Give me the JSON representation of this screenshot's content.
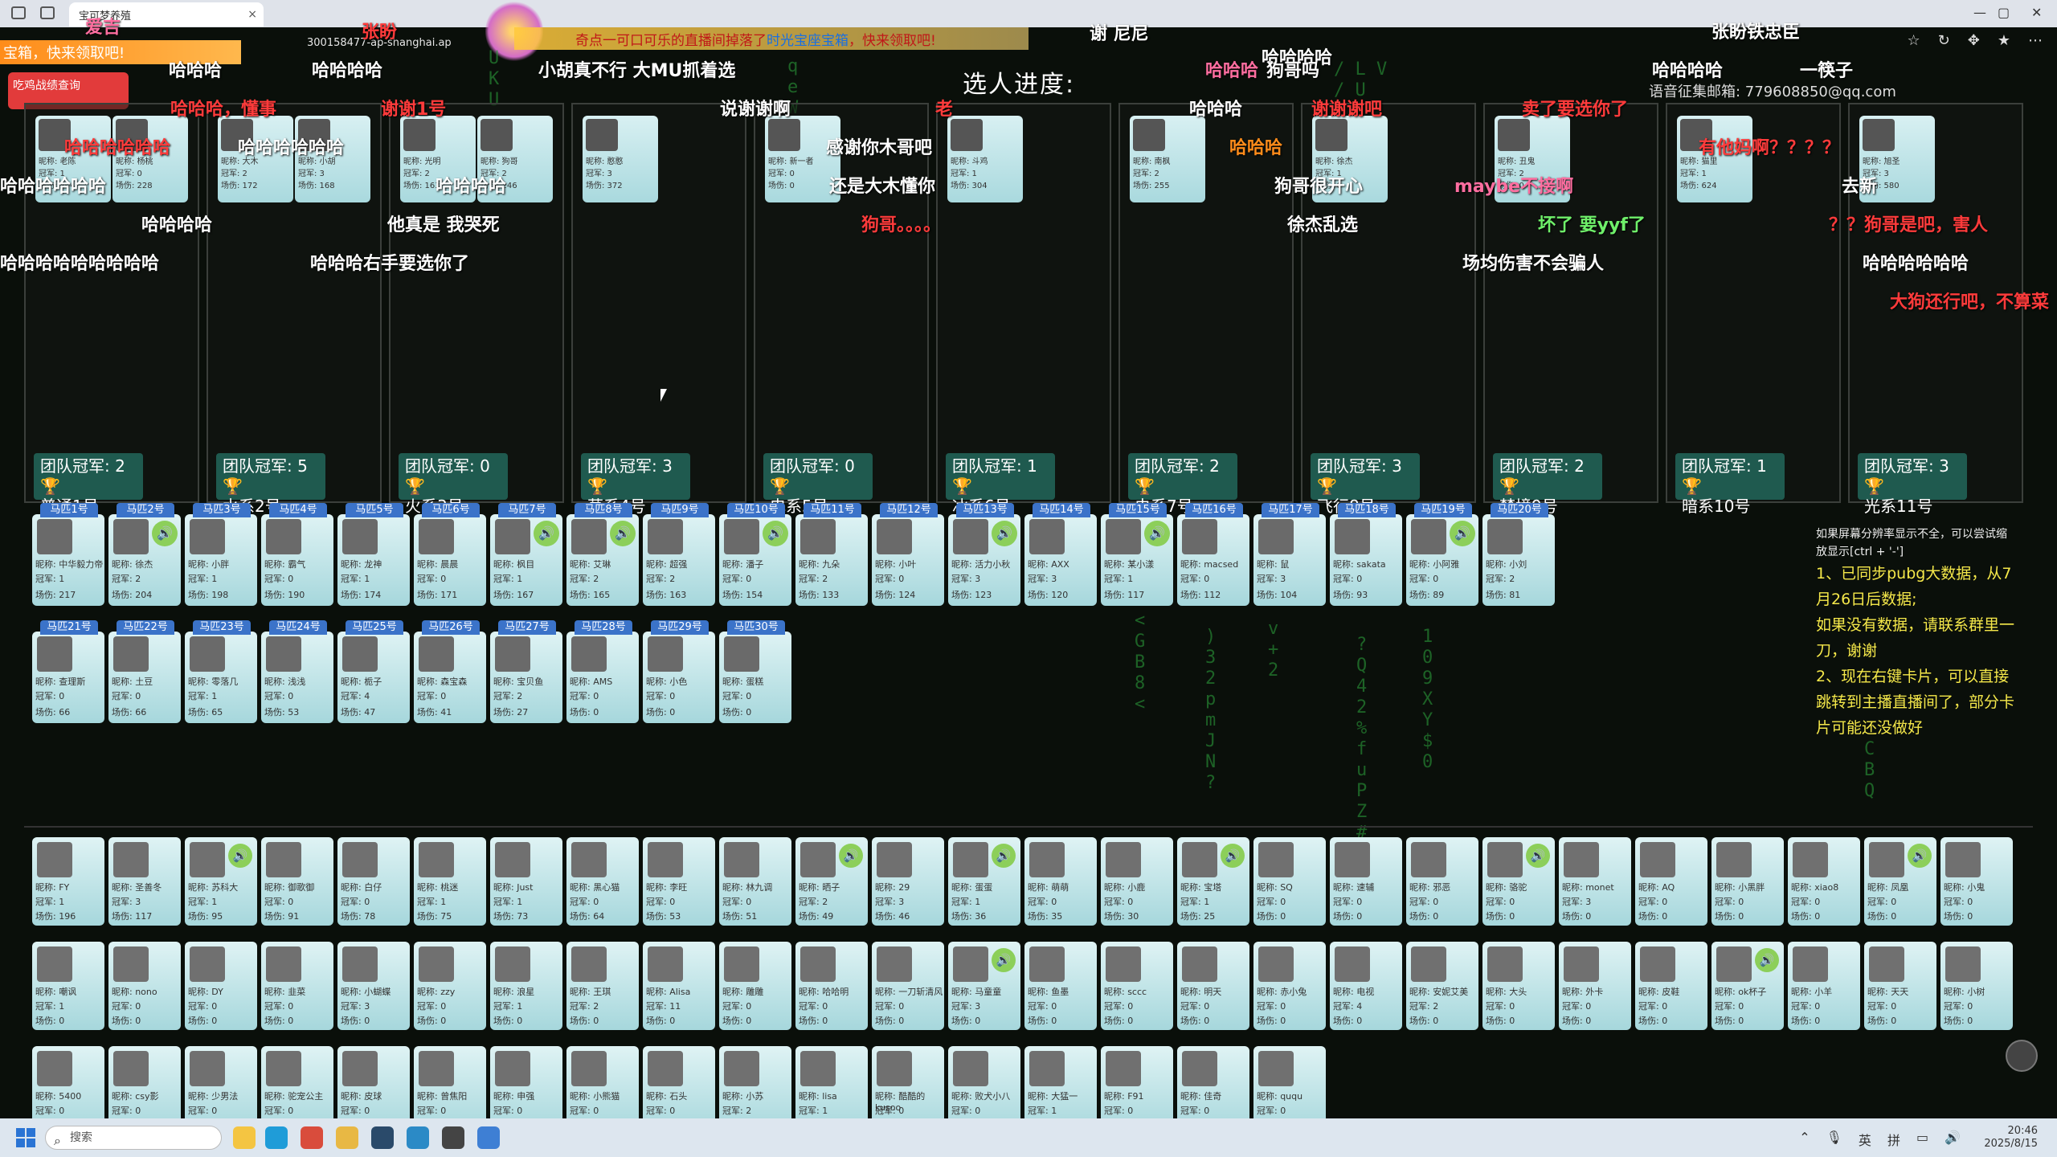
{
  "browser": {
    "tab_title": "宝可梦养殖",
    "url": "300158477-ap-shanghai.ap",
    "tab_close": "×"
  },
  "banner": {
    "prefix": "奇点一可口可乐的直播间掉落了",
    "highlight": "时光宝座宝箱",
    "suffix": "，快来领取吧!"
  },
  "left_promo": "宝箱，快来领取吧!",
  "left_box": "吃鸡战绩查询",
  "stage_title": "选人进度:",
  "contact": "语音征集邮箱: 779608850@qq.com",
  "teams": [
    {
      "badge_count": "团队冠军: 2",
      "name": "普通1号"
    },
    {
      "badge_count": "团队冠军: 5",
      "name": "水系2号"
    },
    {
      "badge_count": "团队冠军: 0",
      "name": "火系3号"
    },
    {
      "badge_count": "团队冠军: 3",
      "name": "草系4号"
    },
    {
      "badge_count": "团队冠军: 0",
      "name": "电系5号"
    },
    {
      "badge_count": "团队冠军: 1",
      "name": "冰系6号"
    },
    {
      "badge_count": "团队冠军: 2",
      "name": "虫系7号"
    },
    {
      "badge_count": "团队冠军: 3",
      "name": "飞行8号"
    },
    {
      "badge_count": "团队冠军: 2",
      "name": "梦境9号"
    },
    {
      "badge_count": "团队冠军: 1",
      "name": "暗系10号"
    },
    {
      "badge_count": "团队冠军: 3",
      "name": "光系11号"
    }
  ],
  "team_members": [
    [
      {
        "nick": "昵称: 老陈",
        "crown": "冠军: 1",
        "games": "场伤: 204"
      },
      {
        "nick": "昵称: 杨桃",
        "crown": "冠军: 0",
        "games": "场伤: 228"
      }
    ],
    [
      {
        "nick": "昵称: 大木",
        "crown": "冠军: 2",
        "games": "场伤: 172"
      },
      {
        "nick": "昵称: 小胡",
        "crown": "冠军: 3",
        "games": "场伤: 168"
      }
    ],
    [
      {
        "nick": "昵称: 光明",
        "crown": "冠军: 2",
        "games": "场伤: 163"
      },
      {
        "nick": "昵称: 狗哥",
        "crown": "冠军: 2",
        "games": "场伤: 246"
      }
    ],
    [
      {
        "nick": "昵称: 憨憨",
        "crown": "冠军: 3",
        "games": "场伤: 372"
      }
    ],
    [
      {
        "nick": "昵称: 新一者",
        "crown": "冠军: 0",
        "games": "场伤: 0"
      }
    ],
    [
      {
        "nick": "昵称: 斗鸡",
        "crown": "冠军: 1",
        "games": "场伤: 304"
      }
    ],
    [
      {
        "nick": "昵称: 南枫",
        "crown": "冠军: 2",
        "games": "场伤: 255"
      }
    ],
    [
      {
        "nick": "昵称: 徐杰",
        "crown": "冠军: 1",
        "games": "场伤: 0"
      }
    ],
    [
      {
        "nick": "昵称: 丑鬼",
        "crown": "冠军: 2",
        "games": "场伤: 0"
      }
    ],
    [
      {
        "nick": "昵称: 猫里",
        "crown": "冠军: 1",
        "games": "场伤: 624"
      }
    ],
    [
      {
        "nick": "昵称: 旭圣",
        "crown": "冠军: 3",
        "games": "场伤: 580"
      }
    ]
  ],
  "horse_pool": [
    {
      "tag": "马匹1号",
      "nick": "昵称: 中华毅力帝",
      "crown": "冠军: 1",
      "games": "场伤: 217"
    },
    {
      "tag": "马匹2号",
      "nick": "昵称: 徐杰",
      "crown": "冠军: 2",
      "games": "场伤: 204"
    },
    {
      "tag": "马匹3号",
      "nick": "昵称: 小胖",
      "crown": "冠军: 1",
      "games": "场伤: 198"
    },
    {
      "tag": "马匹4号",
      "nick": "昵称: 霸气",
      "crown": "冠军: 0",
      "games": "场伤: 190"
    },
    {
      "tag": "马匹5号",
      "nick": "昵称: 龙神",
      "crown": "冠军: 1",
      "games": "场伤: 174"
    },
    {
      "tag": "马匹6号",
      "nick": "昵称: 晨晨",
      "crown": "冠军: 0",
      "games": "场伤: 171"
    },
    {
      "tag": "马匹7号",
      "nick": "昵称: 枫目",
      "crown": "冠军: 1",
      "games": "场伤: 167"
    },
    {
      "tag": "马匹8号",
      "nick": "昵称: 艾琳",
      "crown": "冠军: 2",
      "games": "场伤: 165"
    },
    {
      "tag": "马匹9号",
      "nick": "昵称: 超强",
      "crown": "冠军: 2",
      "games": "场伤: 163"
    },
    {
      "tag": "马匹10号",
      "nick": "昵称: 潘子",
      "crown": "冠军: 0",
      "games": "场伤: 154"
    },
    {
      "tag": "马匹11号",
      "nick": "昵称: 九朵",
      "crown": "冠军: 2",
      "games": "场伤: 133"
    },
    {
      "tag": "马匹12号",
      "nick": "昵称: 小叶",
      "crown": "冠军: 0",
      "games": "场伤: 124"
    },
    {
      "tag": "马匹13号",
      "nick": "昵称: 活力小秋",
      "crown": "冠军: 3",
      "games": "场伤: 123"
    },
    {
      "tag": "马匹14号",
      "nick": "昵称: AXX",
      "crown": "冠军: 3",
      "games": "场伤: 120"
    },
    {
      "tag": "马匹15号",
      "nick": "昵称: 某小漾",
      "crown": "冠军: 1",
      "games": "场伤: 117"
    },
    {
      "tag": "马匹16号",
      "nick": "昵称: macsed",
      "crown": "冠军: 0",
      "games": "场伤: 112"
    },
    {
      "tag": "马匹17号",
      "nick": "昵称: 鼠",
      "crown": "冠军: 3",
      "games": "场伤: 104"
    },
    {
      "tag": "马匹18号",
      "nick": "昵称: sakata",
      "crown": "冠军: 0",
      "games": "场伤: 93"
    },
    {
      "tag": "马匹19号",
      "nick": "昵称: 小阿雅",
      "crown": "冠军: 0",
      "games": "场伤: 89"
    },
    {
      "tag": "马匹20号",
      "nick": "昵称: 小刘",
      "crown": "冠军: 2",
      "games": "场伤: 81"
    },
    {
      "tag": "马匹21号",
      "nick": "昵称: 查理斯",
      "crown": "冠军: 0",
      "games": "场伤: 66"
    },
    {
      "tag": "马匹22号",
      "nick": "昵称: 土豆",
      "crown": "冠军: 0",
      "games": "场伤: 66"
    },
    {
      "tag": "马匹23号",
      "nick": "昵称: 零落几",
      "crown": "冠军: 1",
      "games": "场伤: 65"
    },
    {
      "tag": "马匹24号",
      "nick": "昵称: 浅浅",
      "crown": "冠军: 0",
      "games": "场伤: 53"
    },
    {
      "tag": "马匹25号",
      "nick": "昵称: 栀子",
      "crown": "冠军: 4",
      "games": "场伤: 47"
    },
    {
      "tag": "马匹26号",
      "nick": "昵称: 森宝森",
      "crown": "冠军: 0",
      "games": "场伤: 41"
    },
    {
      "tag": "马匹27号",
      "nick": "昵称: 宝贝鱼",
      "crown": "冠军: 2",
      "games": "场伤: 27"
    },
    {
      "tag": "马匹28号",
      "nick": "昵称: AMS",
      "crown": "冠军: 0",
      "games": "场伤: 0"
    },
    {
      "tag": "马匹29号",
      "nick": "昵称: 小色",
      "crown": "冠军: 0",
      "games": "场伤: 0"
    },
    {
      "tag": "马匹30号",
      "nick": "昵称: 蛋糕",
      "crown": "冠军: 0",
      "games": "场伤: 0"
    }
  ],
  "audience": [
    {
      "nick": "昵称: FY",
      "crown": "冠军: 1",
      "games": "场伤: 196"
    },
    {
      "nick": "昵称: 圣善冬",
      "crown": "冠军: 3",
      "games": "场伤: 117"
    },
    {
      "nick": "昵称: 苏科大",
      "crown": "冠军: 1",
      "games": "场伤: 95"
    },
    {
      "nick": "昵称: 御歌御",
      "crown": "冠军: 0",
      "games": "场伤: 91"
    },
    {
      "nick": "昵称: 白仔",
      "crown": "冠军: 0",
      "games": "场伤: 78"
    },
    {
      "nick": "昵称: 桃迷",
      "crown": "冠军: 1",
      "games": "场伤: 75"
    },
    {
      "nick": "昵称: Just",
      "crown": "冠军: 1",
      "games": "场伤: 73"
    },
    {
      "nick": "昵称: 黑心猫",
      "crown": "冠军: 0",
      "games": "场伤: 64"
    },
    {
      "nick": "昵称: 李旺",
      "crown": "冠军: 0",
      "games": "场伤: 53"
    },
    {
      "nick": "昵称: 林九调",
      "crown": "冠军: 0",
      "games": "场伤: 51"
    },
    {
      "nick": "昵称: 晒子",
      "crown": "冠军: 2",
      "games": "场伤: 49"
    },
    {
      "nick": "昵称: 29",
      "crown": "冠军: 3",
      "games": "场伤: 46"
    },
    {
      "nick": "昵称: 蛋蛋",
      "crown": "冠军: 1",
      "games": "场伤: 36"
    },
    {
      "nick": "昵称: 萌萌",
      "crown": "冠军: 0",
      "games": "场伤: 35"
    },
    {
      "nick": "昵称: 小鹿",
      "crown": "冠军: 0",
      "games": "场伤: 30"
    },
    {
      "nick": "昵称: 宝塔",
      "crown": "冠军: 1",
      "games": "场伤: 25"
    },
    {
      "nick": "昵称: SQ",
      "crown": "冠军: 0",
      "games": "场伤: 0"
    },
    {
      "nick": "昵称: 速辅",
      "crown": "冠军: 0",
      "games": "场伤: 0"
    },
    {
      "nick": "昵称: 邪恶",
      "crown": "冠军: 0",
      "games": "场伤: 0"
    },
    {
      "nick": "昵称: 骆驼",
      "crown": "冠军: 0",
      "games": "场伤: 0"
    },
    {
      "nick": "昵称: monet",
      "crown": "冠军: 3",
      "games": "场伤: 0"
    },
    {
      "nick": "昵称: AQ",
      "crown": "冠军: 0",
      "games": "场伤: 0"
    },
    {
      "nick": "昵称: 小黑胖",
      "crown": "冠军: 0",
      "games": "场伤: 0"
    },
    {
      "nick": "昵称: xiao8",
      "crown": "冠军: 0",
      "games": "场伤: 0"
    },
    {
      "nick": "昵称: 凤凰",
      "crown": "冠军: 0",
      "games": "场伤: 0"
    },
    {
      "nick": "昵称: 小鬼",
      "crown": "冠军: 0",
      "games": "场伤: 0"
    },
    {
      "nick": "昵称: 嘲讽",
      "crown": "冠军: 1",
      "games": "场伤: 0"
    },
    {
      "nick": "昵称: nono",
      "crown": "冠军: 0",
      "games": "场伤: 0"
    },
    {
      "nick": "昵称: DY",
      "crown": "冠军: 0",
      "games": "场伤: 0"
    },
    {
      "nick": "昵称: 韭菜",
      "crown": "冠军: 0",
      "games": "场伤: 0"
    },
    {
      "nick": "昵称: 小蝴蝶",
      "crown": "冠军: 3",
      "games": "场伤: 0"
    },
    {
      "nick": "昵称: zzy",
      "crown": "冠军: 0",
      "games": "场伤: 0"
    },
    {
      "nick": "昵称: 浪星",
      "crown": "冠军: 1",
      "games": "场伤: 0"
    },
    {
      "nick": "昵称: 王琪",
      "crown": "冠军: 2",
      "games": "场伤: 0"
    },
    {
      "nick": "昵称: Alisa",
      "crown": "冠军: 11",
      "games": "场伤: 0"
    },
    {
      "nick": "昵称: 雕雕",
      "crown": "冠军: 0",
      "games": "场伤: 0"
    },
    {
      "nick": "昵称: 哈哈明",
      "crown": "冠军: 0",
      "games": "场伤: 0"
    },
    {
      "nick": "昵称: 一刀斩清风",
      "crown": "冠军: 0",
      "games": "场伤: 0"
    },
    {
      "nick": "昵称: 马童童",
      "crown": "冠军: 3",
      "games": "场伤: 0"
    },
    {
      "nick": "昵称: 鱼墨",
      "crown": "冠军: 0",
      "games": "场伤: 0"
    },
    {
      "nick": "昵称: sccc",
      "crown": "冠军: 0",
      "games": "场伤: 0"
    },
    {
      "nick": "昵称: 明天",
      "crown": "冠军: 0",
      "games": "场伤: 0"
    },
    {
      "nick": "昵称: 赤小兔",
      "crown": "冠军: 0",
      "games": "场伤: 0"
    },
    {
      "nick": "昵称: 电视",
      "crown": "冠军: 4",
      "games": "场伤: 0"
    },
    {
      "nick": "昵称: 安妮艾美",
      "crown": "冠军: 2",
      "games": "场伤: 0"
    },
    {
      "nick": "昵称: 大头",
      "crown": "冠军: 0",
      "games": "场伤: 0"
    },
    {
      "nick": "昵称: 外卡",
      "crown": "冠军: 0",
      "games": "场伤: 0"
    },
    {
      "nick": "昵称: 皮鞋",
      "crown": "冠军: 0",
      "games": "场伤: 0"
    },
    {
      "nick": "昵称: ok杯子",
      "crown": "冠军: 0",
      "games": "场伤: 0"
    },
    {
      "nick": "昵称: 小羊",
      "crown": "冠军: 0",
      "games": "场伤: 0"
    },
    {
      "nick": "昵称: 天天",
      "crown": "冠军: 0",
      "games": "场伤: 0"
    },
    {
      "nick": "昵称: 小树",
      "crown": "冠军: 0",
      "games": "场伤: 0"
    },
    {
      "nick": "昵称: 5400",
      "crown": "冠军: 0",
      "games": "场伤: 0"
    },
    {
      "nick": "昵称: csy影",
      "crown": "冠军: 0",
      "games": "场伤: 0"
    },
    {
      "nick": "昵称: 少男法",
      "crown": "冠军: 0",
      "games": "场伤: 0"
    },
    {
      "nick": "昵称: 驼宠公主",
      "crown": "冠军: 0",
      "games": "场伤: 0"
    },
    {
      "nick": "昵称: 皮球",
      "crown": "冠军: 0",
      "games": "场伤: 0"
    },
    {
      "nick": "昵称: 曾焦阳",
      "crown": "冠军: 0",
      "games": "场伤: 0"
    },
    {
      "nick": "昵称: 申强",
      "crown": "冠军: 0",
      "games": "场伤: 0"
    },
    {
      "nick": "昵称: 小熊猫",
      "crown": "冠军: 0",
      "games": "场伤: 0"
    },
    {
      "nick": "昵称: 石头",
      "crown": "冠军: 0",
      "games": "场伤: 0"
    },
    {
      "nick": "昵称: 小苏",
      "crown": "冠军: 2",
      "games": "场伤: 0"
    },
    {
      "nick": "昵称: lisa",
      "crown": "冠军: 1",
      "games": "场伤: 0"
    },
    {
      "nick": "昵称: 酷酷的kusoo",
      "crown": "冠军: 0",
      "games": "场伤: 0"
    },
    {
      "nick": "昵称: 败犬小八",
      "crown": "冠军: 0",
      "games": "场伤: 0"
    },
    {
      "nick": "昵称: 大猛一",
      "crown": "冠军: 1",
      "games": "场伤: 0"
    },
    {
      "nick": "昵称: F91",
      "crown": "冠军: 0",
      "games": "场伤: 0"
    },
    {
      "nick": "昵称: 佳奇",
      "crown": "冠军: 0",
      "games": "场伤: 0"
    },
    {
      "nick": "昵称: ququ",
      "crown": "冠军: 0",
      "games": "场伤: 0"
    }
  ],
  "tips": {
    "small": "如果屏幕分辨率显示不全，可以尝试缩放显示[ctrl + '-']",
    "line1": "1、已同步pubg大数据，从7月26日后数据;",
    "line2": "如果没有数据，请联系群里一刀，谢谢",
    "line3": "2、现在右键卡片，可以直接跳转到主播直播间了，部分卡片可能还没做好"
  },
  "danmaku": [
    {
      "text": "爱吉",
      "cls": "pink"
    },
    {
      "text": "张盼",
      "cls": "red"
    },
    {
      "text": "哈哈哈",
      "cls": "white"
    },
    {
      "text": "哈哈哈哈",
      "cls": "white"
    },
    {
      "text": "小胡真不行 大MU抓着选",
      "cls": "white"
    },
    {
      "text": "哈哈哈",
      "cls": "pink"
    },
    {
      "text": "谢 尼尼",
      "cls": "white"
    },
    {
      "text": "哈哈哈哈",
      "cls": "white"
    },
    {
      "text": "张盼铁忠臣",
      "cls": "white"
    },
    {
      "text": "哈哈哈，懂事",
      "cls": "red"
    },
    {
      "text": "谢谢1号",
      "cls": "red"
    },
    {
      "text": "说谢谢啊",
      "cls": "white"
    },
    {
      "text": "老",
      "cls": "red"
    },
    {
      "text": "哈哈哈",
      "cls": "white"
    },
    {
      "text": "谢谢谢吧",
      "cls": "red"
    },
    {
      "text": "卖了要选你了",
      "cls": "red"
    },
    {
      "text": "狗哥吗",
      "cls": "white"
    },
    {
      "text": "一筷子",
      "cls": "white"
    },
    {
      "text": "哈哈哈哈",
      "cls": "white"
    },
    {
      "text": "哈哈哈哈哈哈",
      "cls": "red"
    },
    {
      "text": "哈哈哈哈哈哈",
      "cls": "white"
    },
    {
      "text": "感谢你木哥吧",
      "cls": "white"
    },
    {
      "text": "哈哈哈",
      "cls": "orange"
    },
    {
      "text": "有他妈啊？？？？",
      "cls": "red"
    },
    {
      "text": "哈哈哈哈哈哈",
      "cls": "white"
    },
    {
      "text": "哈哈哈哈",
      "cls": "white"
    },
    {
      "text": "还是大木懂你",
      "cls": "white"
    },
    {
      "text": "狗哥很开心",
      "cls": "white"
    },
    {
      "text": "maybe不接啊",
      "cls": "pink"
    },
    {
      "text": "去新",
      "cls": "white"
    },
    {
      "text": "哈哈哈哈",
      "cls": "white"
    },
    {
      "text": "他真是 我哭死",
      "cls": "white"
    },
    {
      "text": "狗哥。。。。",
      "cls": "red"
    },
    {
      "text": "徐杰乱选",
      "cls": "white"
    },
    {
      "text": "坏了 要yyf了",
      "cls": "green"
    },
    {
      "text": "？？狗哥是吧，害人",
      "cls": "red"
    },
    {
      "text": "哈哈哈哈哈哈哈哈哈",
      "cls": "white"
    },
    {
      "text": "哈哈哈右手要选你了",
      "cls": "white"
    },
    {
      "text": "场均伤害不会骗人",
      "cls": "white"
    },
    {
      "text": "哈哈哈哈哈哈",
      "cls": "white"
    },
    {
      "text": "大狗还行吧，不算菜",
      "cls": "red"
    }
  ],
  "taskbar": {
    "search": "搜索",
    "time": "20:46",
    "date": "2025/8/15",
    "lang": "英",
    "ime": "拼"
  },
  "colors": {
    "badge_bg": "#1f5a4f",
    "card_top": "#dff3f4",
    "card_bottom": "#a6d7dc",
    "tag_blue": "#3b73c9",
    "trophy": "#f2c230"
  }
}
